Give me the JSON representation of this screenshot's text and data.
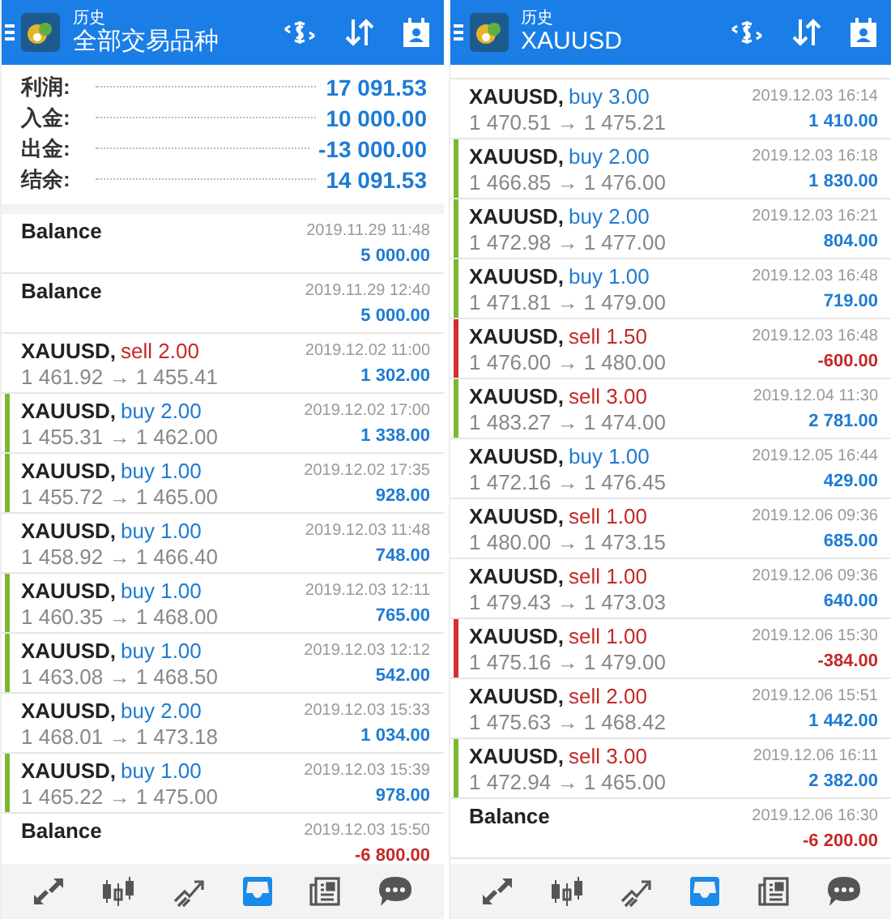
{
  "panels": [
    {
      "header": {
        "title": "历史",
        "subtitle": "全部交易品种"
      },
      "summary": [
        {
          "label": "利润:",
          "value": "17 091.53"
        },
        {
          "label": "入金:",
          "value": "10 000.00"
        },
        {
          "label": "出金:",
          "value": "-13 000.00"
        },
        {
          "label": "结余:",
          "value": "14 091.53"
        }
      ],
      "entries": [
        {
          "kind": "balance",
          "name": "Balance",
          "time": "2019.11.29 11:48",
          "profit": "5 000.00",
          "loss": false
        },
        {
          "kind": "balance",
          "name": "Balance",
          "time": "2019.11.29 12:40",
          "profit": "5 000.00",
          "loss": false
        },
        {
          "kind": "sell",
          "name": "XAUUSD,",
          "order": "sell 2.00",
          "prices": "1 461.92 → 1 455.41",
          "time": "2019.12.02 11:00",
          "profit": "1 302.00",
          "loss": false
        },
        {
          "kind": "buy",
          "name": "XAUUSD,",
          "order": "buy 2.00",
          "prices": "1 455.31 → 1 462.00",
          "time": "2019.12.02 17:00",
          "profit": "1 338.00",
          "loss": false,
          "color": "#7cb82f"
        },
        {
          "kind": "buy",
          "name": "XAUUSD,",
          "order": "buy 1.00",
          "prices": "1 455.72 → 1 465.00",
          "time": "2019.12.02 17:35",
          "profit": "928.00",
          "loss": false,
          "color": "#7cb82f"
        },
        {
          "kind": "buy",
          "name": "XAUUSD,",
          "order": "buy 1.00",
          "prices": "1 458.92 → 1 466.40",
          "time": "2019.12.03 11:48",
          "profit": "748.00",
          "loss": false
        },
        {
          "kind": "buy",
          "name": "XAUUSD,",
          "order": "buy 1.00",
          "prices": "1 460.35 → 1 468.00",
          "time": "2019.12.03 12:11",
          "profit": "765.00",
          "loss": false,
          "color": "#7cb82f"
        },
        {
          "kind": "buy",
          "name": "XAUUSD,",
          "order": "buy 1.00",
          "prices": "1 463.08 → 1 468.50",
          "time": "2019.12.03 12:12",
          "profit": "542.00",
          "loss": false,
          "color": "#7cb82f"
        },
        {
          "kind": "buy",
          "name": "XAUUSD,",
          "order": "buy 2.00",
          "prices": "1 468.01 → 1 473.18",
          "time": "2019.12.03 15:33",
          "profit": "1 034.00",
          "loss": false
        },
        {
          "kind": "buy",
          "name": "XAUUSD,",
          "order": "buy 1.00",
          "prices": "1 465.22 → 1 475.00",
          "time": "2019.12.03 15:39",
          "profit": "978.00",
          "loss": false,
          "color": "#7cb82f"
        },
        {
          "kind": "balance",
          "name": "Balance",
          "time": "2019.12.03 15:50",
          "profit": "-6 800.00",
          "loss": true
        }
      ],
      "nav": [
        {
          "selected": false
        },
        {
          "selected": false
        },
        {
          "selected": false
        },
        {
          "selected": true
        },
        {
          "selected": false
        },
        {
          "selected": false
        }
      ]
    },
    {
      "header": {
        "title": "历史",
        "subtitle": "XAUUSD"
      },
      "entries": [
        {
          "kind": "buy",
          "name": "XAUUSD,",
          "order": "buy 3.00",
          "prices": "1 470.51 → 1 475.21",
          "time": "2019.12.03 16:14",
          "profit": "1 410.00",
          "loss": false
        },
        {
          "kind": "buy",
          "name": "XAUUSD,",
          "order": "buy 2.00",
          "prices": "1 466.85 → 1 476.00",
          "time": "2019.12.03 16:18",
          "profit": "1 830.00",
          "loss": false,
          "color": "#7cb82f"
        },
        {
          "kind": "buy",
          "name": "XAUUSD,",
          "order": "buy 2.00",
          "prices": "1 472.98 → 1 477.00",
          "time": "2019.12.03 16:21",
          "profit": "804.00",
          "loss": false,
          "color": "#7cb82f"
        },
        {
          "kind": "buy",
          "name": "XAUUSD,",
          "order": "buy 1.00",
          "prices": "1 471.81 → 1 479.00",
          "time": "2019.12.03 16:48",
          "profit": "719.00",
          "loss": false,
          "color": "#7cb82f"
        },
        {
          "kind": "sell",
          "name": "XAUUSD,",
          "order": "sell 1.50",
          "prices": "1 476.00 → 1 480.00",
          "time": "2019.12.03 16:48",
          "profit": "-600.00",
          "loss": true,
          "color": "#d32f2f"
        },
        {
          "kind": "sell",
          "name": "XAUUSD,",
          "order": "sell 3.00",
          "prices": "1 483.27 → 1 474.00",
          "time": "2019.12.04 11:30",
          "profit": "2 781.00",
          "loss": false,
          "color": "#7cb82f"
        },
        {
          "kind": "buy",
          "name": "XAUUSD,",
          "order": "buy 1.00",
          "prices": "1 472.16 → 1 476.45",
          "time": "2019.12.05 16:44",
          "profit": "429.00",
          "loss": false
        },
        {
          "kind": "sell",
          "name": "XAUUSD,",
          "order": "sell 1.00",
          "prices": "1 480.00 → 1 473.15",
          "time": "2019.12.06 09:36",
          "profit": "685.00",
          "loss": false
        },
        {
          "kind": "sell",
          "name": "XAUUSD,",
          "order": "sell 1.00",
          "prices": "1 479.43 → 1 473.03",
          "time": "2019.12.06 09:36",
          "profit": "640.00",
          "loss": false
        },
        {
          "kind": "sell",
          "name": "XAUUSD,",
          "order": "sell 1.00",
          "prices": "1 475.16 → 1 479.00",
          "time": "2019.12.06 15:30",
          "profit": "-384.00",
          "loss": true,
          "color": "#d32f2f"
        },
        {
          "kind": "sell",
          "name": "XAUUSD,",
          "order": "sell 2.00",
          "prices": "1 475.63 → 1 468.42",
          "time": "2019.12.06 15:51",
          "profit": "1 442.00",
          "loss": false
        },
        {
          "kind": "sell",
          "name": "XAUUSD,",
          "order": "sell 3.00",
          "prices": "1 472.94 → 1 465.00",
          "time": "2019.12.06 16:11",
          "profit": "2 382.00",
          "loss": false,
          "color": "#7cb82f"
        },
        {
          "kind": "balance",
          "name": "Balance",
          "time": "2019.12.06 16:30",
          "profit": "-6 200.00",
          "loss": true
        }
      ],
      "nav": [
        {
          "selected": false
        },
        {
          "selected": false
        },
        {
          "selected": false
        },
        {
          "selected": true
        },
        {
          "selected": false
        },
        {
          "selected": false
        }
      ]
    }
  ]
}
